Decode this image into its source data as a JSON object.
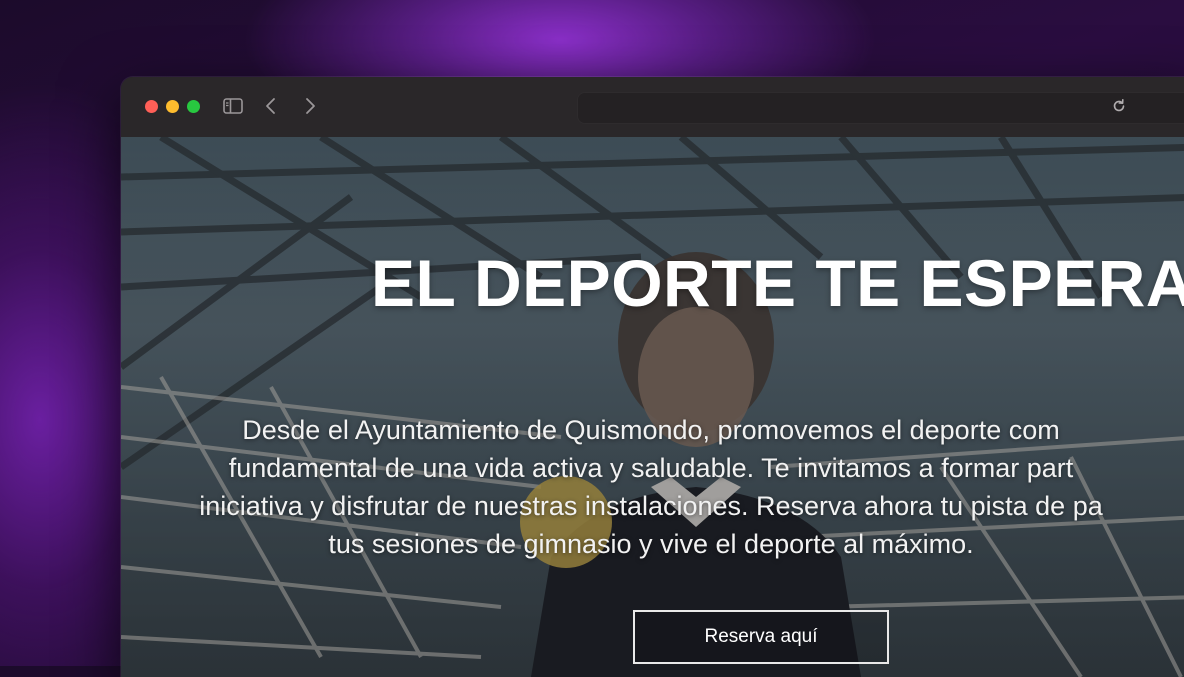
{
  "browser": {
    "url_text": "",
    "icons": {
      "sidebar_toggle": "sidebar-icon",
      "back": "chevron-left-icon",
      "forward": "chevron-right-icon",
      "reload": "reload-icon"
    },
    "traffic_colors": {
      "close": "#ff5f57",
      "minimize": "#febc2e",
      "zoom": "#28c840"
    }
  },
  "hero": {
    "headline": "EL DEPORTE TE ESPERA",
    "tagline_lines": [
      "Desde el Ayuntamiento de Quismondo, promovemos el deporte com",
      "fundamental de una vida activa y saludable. Te invitamos a formar part",
      "iniciativa y disfrutar de nuestras instalaciones. Reserva ahora tu pista de pa",
      "tus sesiones de gimnasio y vive el deporte al máximo."
    ],
    "cta_label": "Reserva aquí"
  },
  "colors": {
    "background_accent": "#8a2fc8",
    "headline": "#ffffff",
    "cta_border": "#e9e9e9"
  }
}
